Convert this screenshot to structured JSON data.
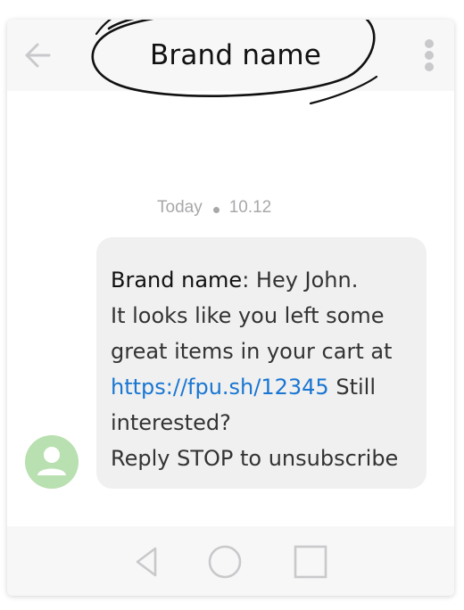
{
  "header": {
    "title": "Brand name",
    "back_icon": "arrow-left-icon",
    "menu_icon": "more-vertical-icon"
  },
  "conversation": {
    "timestamp": {
      "day": "Today",
      "time": "10.12"
    },
    "message": {
      "sender": "Brand name",
      "line1_rest": ": Hey John.",
      "line2": "It looks like you left some",
      "line3": "great items in your cart at",
      "link": "https://fpu.sh/12345",
      "line4_rest": " Still",
      "line5": "interested?",
      "line6": "Reply STOP to unsubscribe"
    },
    "avatar_icon": "user-avatar-icon",
    "avatar_color": "#b9e0b0"
  },
  "navbar": {
    "back_icon": "triangle-back-icon",
    "home_icon": "circle-home-icon",
    "recents_icon": "square-recents-icon"
  },
  "colors": {
    "link": "#1976d2",
    "bubble": "#f0f0f0",
    "bar": "#f7f7f8",
    "icon": "#c9c9cc"
  }
}
